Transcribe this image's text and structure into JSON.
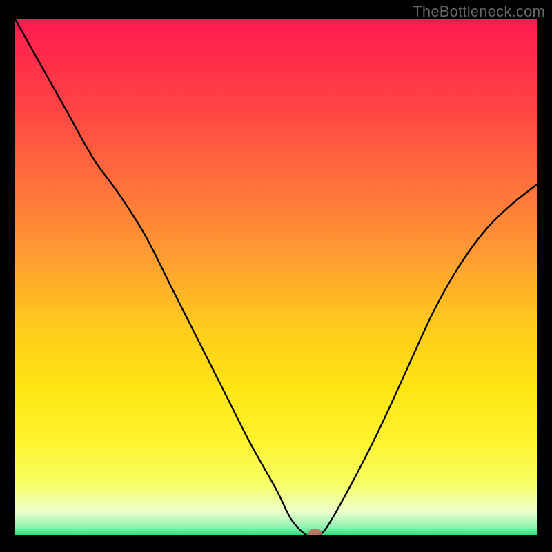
{
  "watermark": "TheBottleneck.com",
  "chart_data": {
    "type": "line",
    "title": "",
    "xlabel": "",
    "ylabel": "",
    "xlim": [
      0,
      100
    ],
    "ylim": [
      0,
      100
    ],
    "grid": false,
    "legend": false,
    "series": [
      {
        "name": "bottleneck-curve",
        "x": [
          0,
          5,
          10,
          15,
          20,
          25,
          30,
          35,
          40,
          45,
          50,
          53,
          56,
          58,
          60,
          65,
          70,
          75,
          80,
          85,
          90,
          95,
          100
        ],
        "y": [
          100,
          91,
          82,
          73,
          66,
          58,
          48,
          38,
          28,
          18,
          9,
          3,
          0,
          0,
          2,
          11,
          21,
          32,
          43,
          52,
          59,
          64,
          68
        ]
      }
    ],
    "marker": {
      "x": 57.5,
      "y": 0,
      "color": "#c86a5a"
    },
    "gradient_stops": [
      {
        "offset": 0.0,
        "color": "#ff1a4f"
      },
      {
        "offset": 0.15,
        "color": "#ff3e45"
      },
      {
        "offset": 0.3,
        "color": "#ff6a3c"
      },
      {
        "offset": 0.45,
        "color": "#ff9933"
      },
      {
        "offset": 0.6,
        "color": "#ffcc1a"
      },
      {
        "offset": 0.72,
        "color": "#ffe614"
      },
      {
        "offset": 0.82,
        "color": "#fff32e"
      },
      {
        "offset": 0.9,
        "color": "#f8ff66"
      },
      {
        "offset": 0.955,
        "color": "#ecffcc"
      },
      {
        "offset": 0.985,
        "color": "#8cf2b0"
      },
      {
        "offset": 1.0,
        "color": "#19e07a"
      }
    ]
  }
}
